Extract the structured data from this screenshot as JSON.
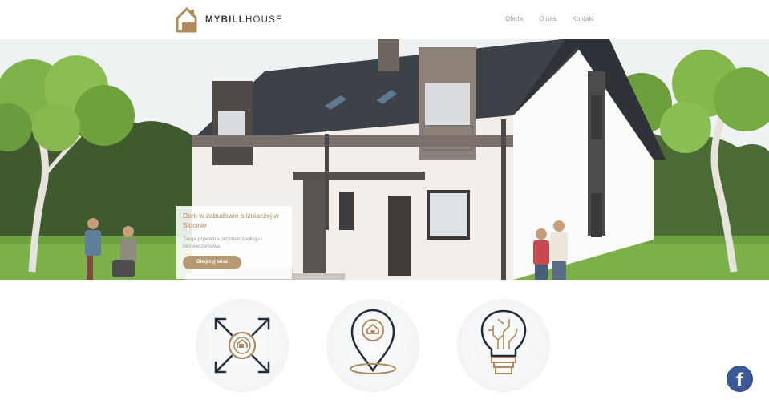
{
  "brand": {
    "name_bold": "MYBILL",
    "name_regular": "HOUSE",
    "logo_icon": "house-logo-icon",
    "accent_color": "#b08a5a"
  },
  "nav": {
    "items": [
      {
        "label": "Oferta"
      },
      {
        "label": "O nas"
      },
      {
        "label": "Kontakt"
      }
    ]
  },
  "hero": {
    "card": {
      "title": "Dom w zabudowie bliźniaczej w Słocinie",
      "subtitle": "Twoja prywatna przystań spokoju i bezpieczeństwa",
      "button_label": "Obejrzyj teraz",
      "button_color": "#b89a72"
    }
  },
  "features": [
    {
      "icon": "expand-arrows-house-icon"
    },
    {
      "icon": "location-pin-house-icon"
    },
    {
      "icon": "lightbulb-circuit-icon"
    }
  ],
  "social": {
    "facebook_label": "f",
    "icon": "facebook-icon",
    "color": "#3b5998"
  }
}
